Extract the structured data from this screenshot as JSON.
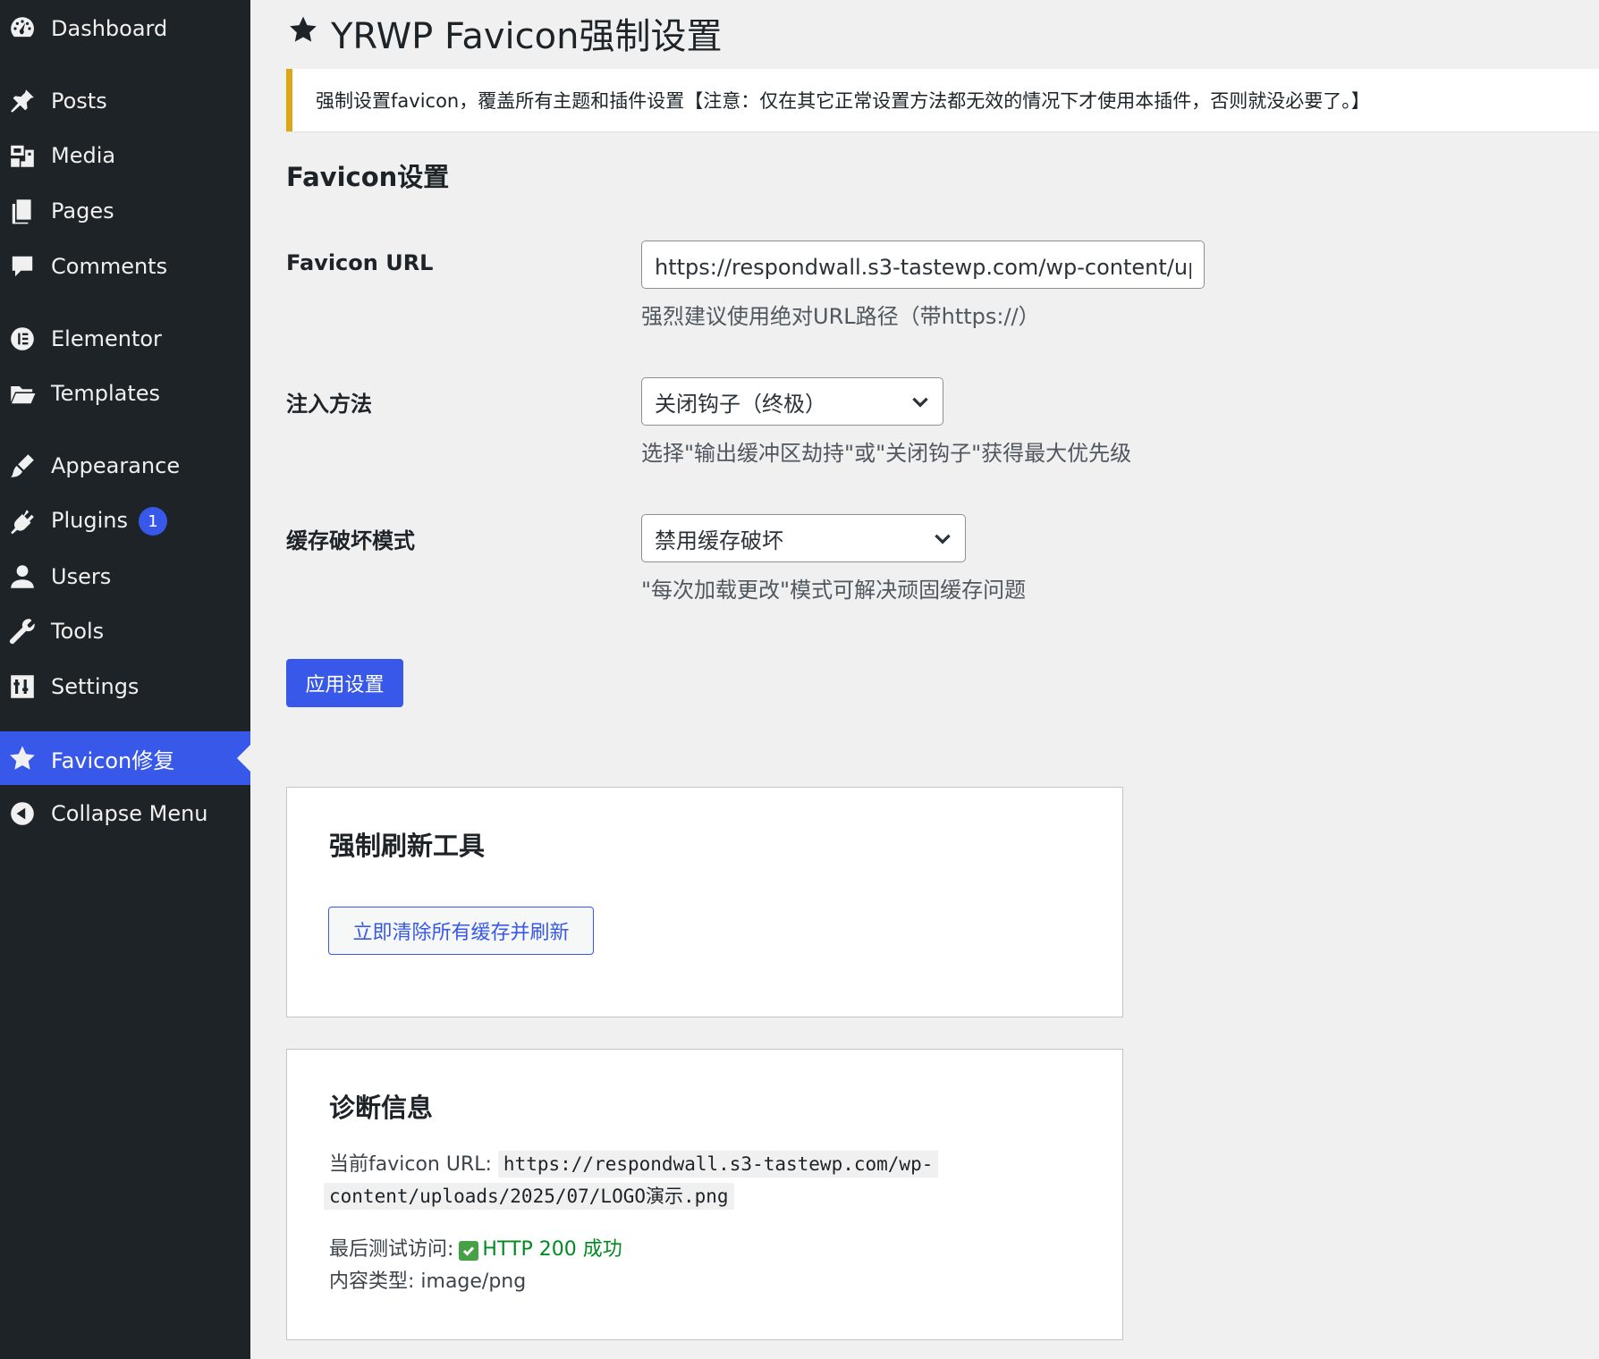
{
  "sidebar": {
    "items": [
      {
        "id": "dashboard",
        "label": "Dashboard",
        "icon": "dashboard-icon"
      },
      {
        "id": "posts",
        "label": "Posts",
        "icon": "pushpin-icon"
      },
      {
        "id": "media",
        "label": "Media",
        "icon": "media-icon"
      },
      {
        "id": "pages",
        "label": "Pages",
        "icon": "pages-icon"
      },
      {
        "id": "comments",
        "label": "Comments",
        "icon": "comment-icon"
      },
      {
        "id": "elementor",
        "label": "Elementor",
        "icon": "elementor-icon"
      },
      {
        "id": "templates",
        "label": "Templates",
        "icon": "folder-icon"
      },
      {
        "id": "appearance",
        "label": "Appearance",
        "icon": "brush-icon"
      },
      {
        "id": "plugins",
        "label": "Plugins",
        "icon": "plugin-icon",
        "badge": "1"
      },
      {
        "id": "users",
        "label": "Users",
        "icon": "user-icon"
      },
      {
        "id": "tools",
        "label": "Tools",
        "icon": "wrench-icon"
      },
      {
        "id": "settings",
        "label": "Settings",
        "icon": "settings-icon"
      },
      {
        "id": "favicon",
        "label": "Favicon修复",
        "icon": "star-icon",
        "active": true
      },
      {
        "id": "collapse",
        "label": "Collapse Menu",
        "icon": "collapse-icon"
      }
    ]
  },
  "page": {
    "title": "YRWP Favicon强制设置",
    "notice": "强制设置favicon，覆盖所有主题和插件设置【注意：仅在其它正常设置方法都无效的情况下才使用本插件，否则就没必要了。】",
    "section_title": "Favicon设置"
  },
  "form": {
    "favicon_url": {
      "label": "Favicon URL",
      "value": "https://respondwall.s3-tastewp.com/wp-content/uploads/2025/07/LOGO演示.png",
      "description": "强烈建议使用绝对URL路径（带https://）"
    },
    "inject_method": {
      "label": "注入方法",
      "selected": "关闭钩子（终极）",
      "description": "选择\"输出缓冲区劫持\"或\"关闭钩子\"获得最大优先级"
    },
    "cache_mode": {
      "label": "缓存破坏模式",
      "selected": "禁用缓存破坏",
      "description": "\"每次加载更改\"模式可解决顽固缓存问题"
    },
    "submit_label": "应用设置"
  },
  "refresh_tool": {
    "title": "强制刷新工具",
    "button_label": "立即清除所有缓存并刷新"
  },
  "diagnostics": {
    "title": "诊断信息",
    "current_label": "当前favicon URL:",
    "current_url_line1": "https://respondwall.s3-tastewp.com/wp-",
    "current_url_line2": "content/uploads/2025/07/LOGO演示.png",
    "last_test_label": "最后测试访问:",
    "last_test_result": "HTTP 200 成功",
    "content_type": "内容类型: image/png"
  },
  "colors": {
    "sidebar_bg": "#1d2327",
    "accent": "#3858e9",
    "notice_border": "#dba617",
    "success": "#008a20"
  }
}
